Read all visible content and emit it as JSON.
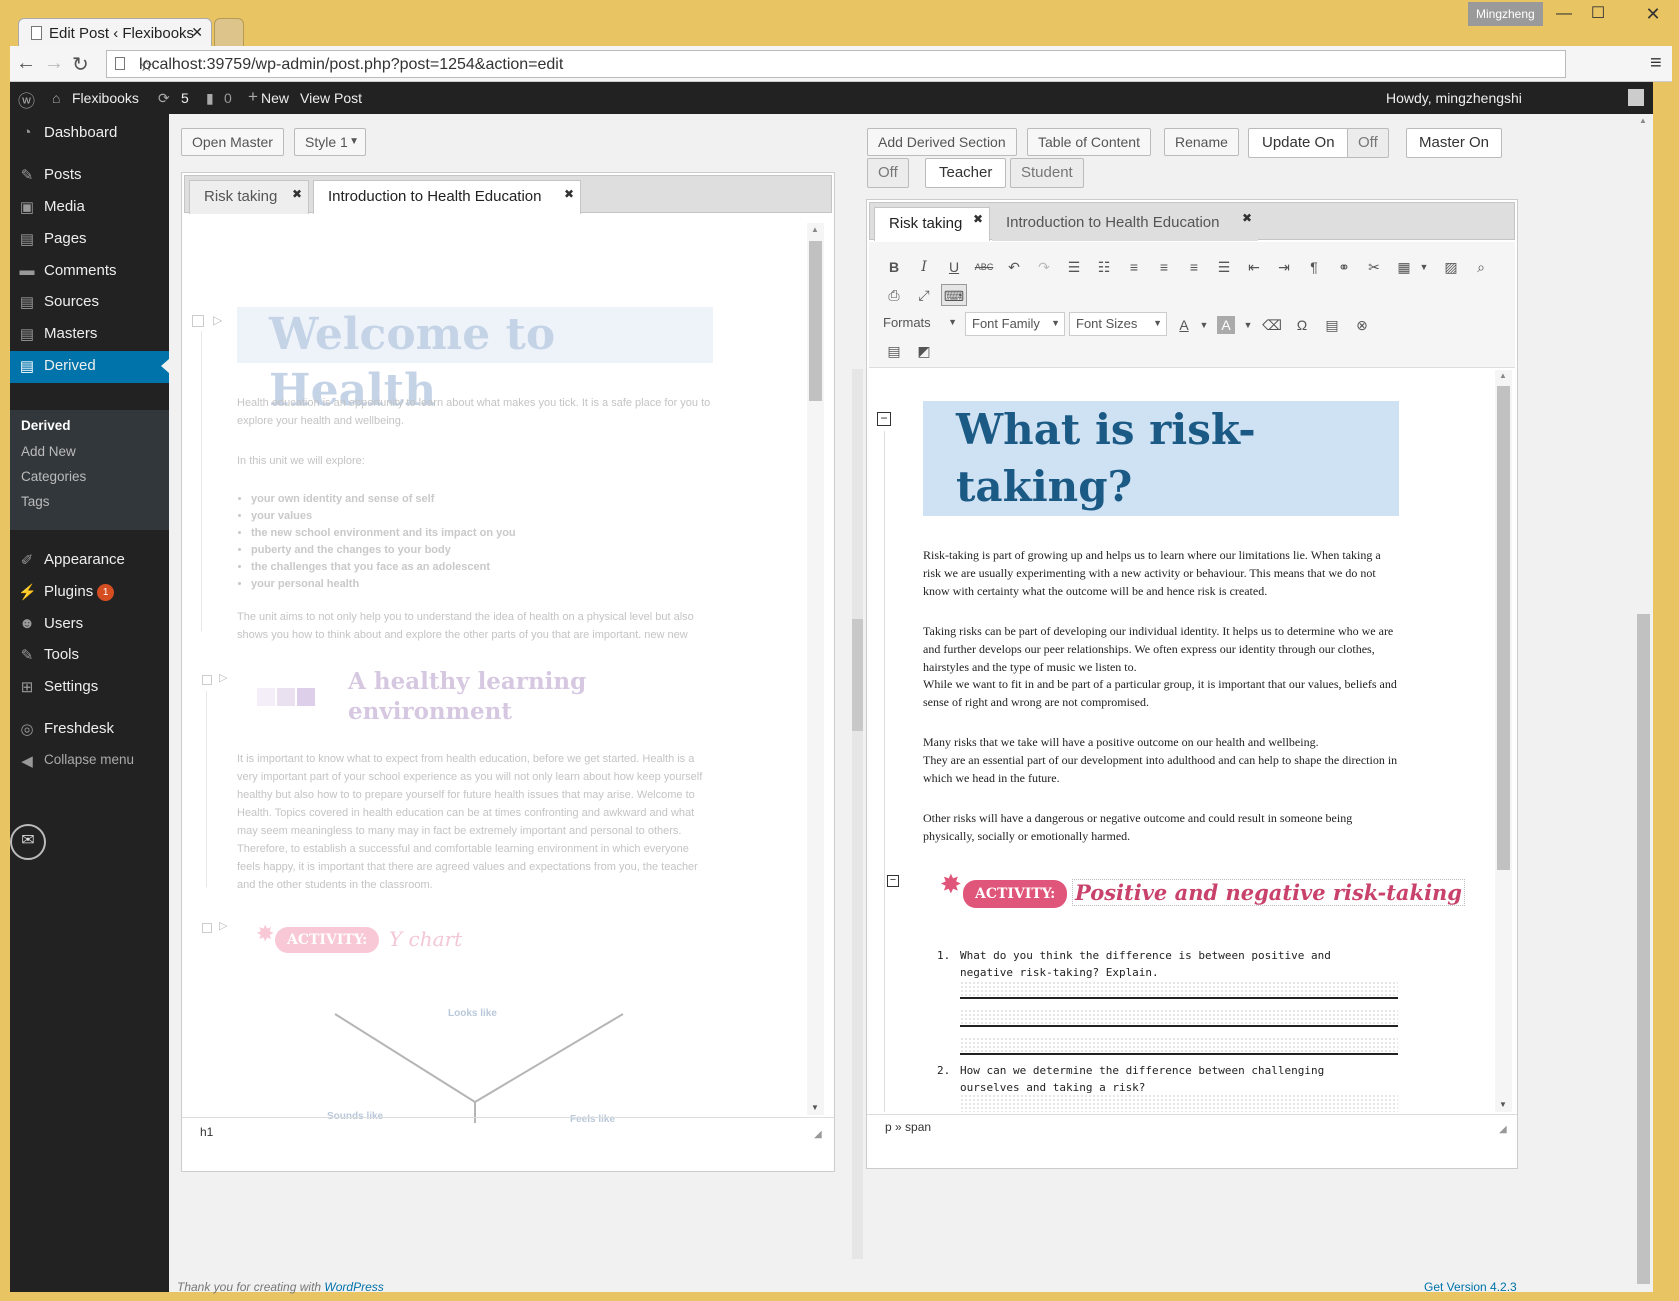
{
  "browser": {
    "tab_title": "Edit Post ‹ Flexibooks",
    "user_badge": "Mingzheng",
    "url": "localhost:39759/wp-admin/post.php?post=1254&action=edit"
  },
  "adminbar": {
    "site": "Flexibooks",
    "updates": "5",
    "comments": "0",
    "new": "New",
    "view_post": "View Post",
    "howdy": "Howdy, mingzhengshi"
  },
  "sidebar": {
    "items": [
      {
        "label": "Dashboard",
        "icon": "dashboard-icon"
      },
      {
        "label": "Posts",
        "icon": "pin-icon"
      },
      {
        "label": "Media",
        "icon": "media-icon"
      },
      {
        "label": "Pages",
        "icon": "pages-icon"
      },
      {
        "label": "Comments",
        "icon": "comment-icon"
      },
      {
        "label": "Sources",
        "icon": "pages-icon"
      },
      {
        "label": "Masters",
        "icon": "pages-icon"
      },
      {
        "label": "Derived",
        "icon": "pages-icon"
      },
      {
        "label": "Appearance",
        "icon": "brush-icon"
      },
      {
        "label": "Plugins",
        "icon": "plugin-icon",
        "badge": "1"
      },
      {
        "label": "Users",
        "icon": "user-icon"
      },
      {
        "label": "Tools",
        "icon": "wrench-icon"
      },
      {
        "label": "Settings",
        "icon": "settings-icon"
      },
      {
        "label": "Freshdesk",
        "icon": "freshdesk-icon"
      },
      {
        "label": "Collapse menu",
        "icon": "collapse-icon"
      }
    ],
    "submenu": [
      "Derived",
      "Add New",
      "Categories",
      "Tags"
    ]
  },
  "left": {
    "open_master": "Open Master",
    "style_select": "Style 1",
    "tabs": [
      "Risk taking",
      "Introduction to Health Education"
    ],
    "heading": "Welcome to Health",
    "p1": "Health education is an opportunity to learn about what makes you tick. It is a safe place for you to explore your health and wellbeing.",
    "p2": "In this unit we will explore:",
    "bullets": [
      "your own identity and sense of self",
      "your values",
      "the new school environment and its impact on you",
      "puberty and the changes to your body",
      "the challenges that you face as an adolescent",
      "your personal health"
    ],
    "p3": "The unit aims to not only help you to understand the idea of health on a physical level but also shows you how to think about and explore the other parts of you that are important. new new",
    "h2_line1": "A healthy learning",
    "h2_line2": "environment",
    "p4": "It is important to know what to expect from health education, before we get started. Health is a very important part of your school experience as you will not only learn about how keep yourself healthy but also how to to prepare yourself for future health issues that may arise. Welcome to Health. Topics covered in health education can be at times confronting and awkward and what may seem meaningless to many may in fact be extremely important and personal to others. Therefore, to establish a successful and comfortable learning environment in which everyone feels happy, it is important that there are agreed values and expectations from you, the teacher and the other students in the classroom.",
    "activity": "ACTIVITY:",
    "activity_title": "Y chart",
    "y_looks": "Looks like",
    "y_sounds": "Sounds like",
    "y_feels": "Feels like",
    "status": "h1"
  },
  "right": {
    "buttons": {
      "add_derived": "Add Derived Section",
      "toc": "Table of Content",
      "rename": "Rename",
      "update_on": "Update On",
      "off1": "Off",
      "master_on": "Master On",
      "off2": "Off",
      "teacher": "Teacher",
      "student": "Student"
    },
    "tabs": [
      "Risk taking",
      "Introduction to Health Education"
    ],
    "toolbar": {
      "formats": "Formats",
      "font_family": "Font Family",
      "font_sizes": "Font Sizes"
    },
    "heading_line1": "What is risk-",
    "heading_line2": "taking?",
    "p1": "Risk-taking is part of growing up and helps us to learn where our limitations lie. When taking a risk we are usually experimenting with a new activity or behaviour. This means that we do not know with certainty what the outcome will be and hence risk is created.",
    "p2a": "Taking risks can be part of developing our individual identity. It helps us to determine who we are and further develops our peer relationships. We often express our identity through our clothes, hairstyles and the type of music we listen to.",
    "p2b": "While we want to fit in and be part of a particular group, it is important that our values, beliefs and sense of right and wrong are not compromised.",
    "p3a": "Many risks that we take will have a positive outcome on our health and wellbeing.",
    "p3b": "They are an essential part of our development into adulthood and can help to shape the direction in which we head in the future.",
    "p4": "Other risks will have a dangerous or negative outcome and could result in someone being physically, socially or emotionally harmed.",
    "activity": "ACTIVITY:",
    "activity_title": "Positive and negative risk-taking",
    "q1_num": "1.",
    "q1": "What do you think the difference is between positive and negative risk-taking? Explain.",
    "q2_num": "2.",
    "q2": "How can we determine the difference between challenging ourselves and taking a risk?",
    "status": "p » span"
  },
  "footer": {
    "thanks_prefix": "Thank you for creating with ",
    "thanks_link": "WordPress",
    "version": "Get Version 4.2.3"
  }
}
